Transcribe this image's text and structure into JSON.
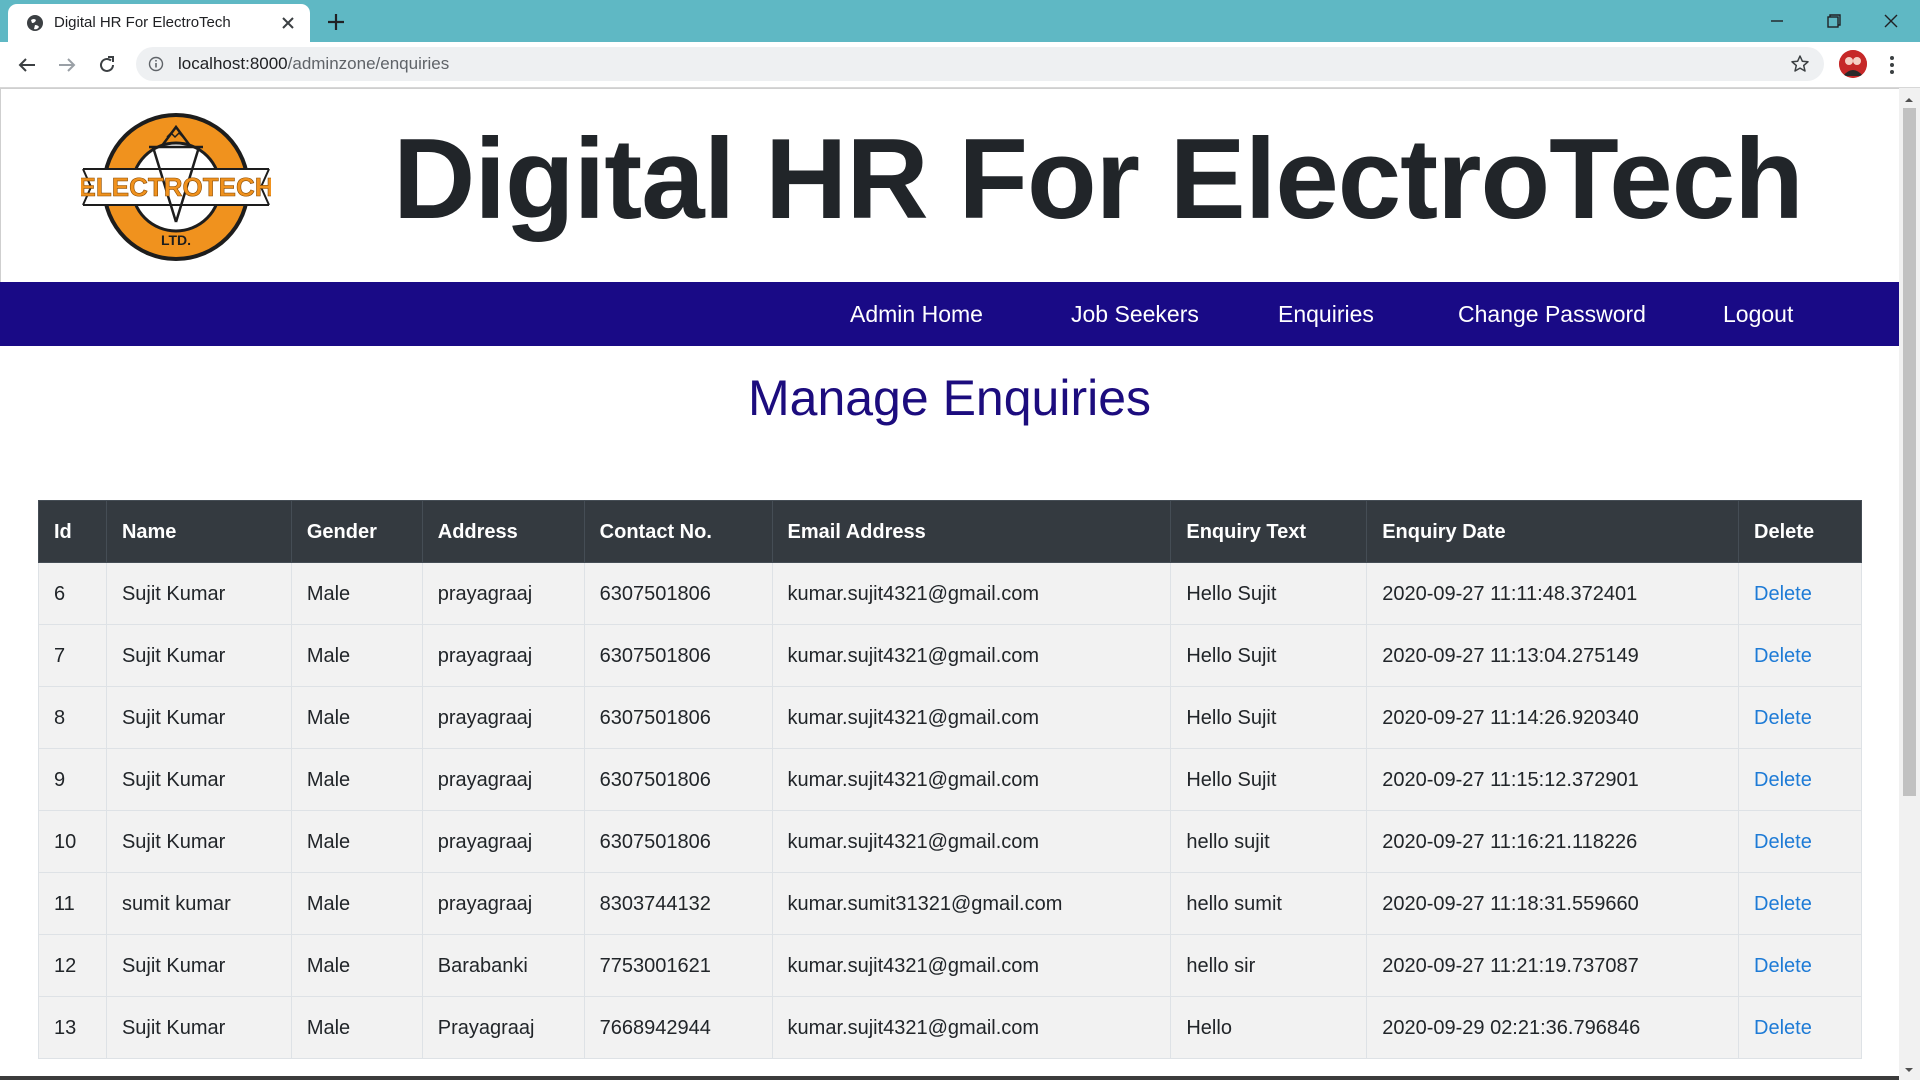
{
  "browser": {
    "tab_title": "Digital HR For ElectroTech",
    "url_host": "localhost:8000",
    "url_path": "/adminzone/enquiries"
  },
  "header": {
    "logo_text": "ELECTROTECH",
    "logo_subtext": "LTD.",
    "site_title": "Digital HR For ElectroTech"
  },
  "nav": {
    "items": [
      {
        "label": "Admin Home"
      },
      {
        "label": "Job Seekers"
      },
      {
        "label": "Enquiries"
      },
      {
        "label": "Change Password"
      },
      {
        "label": "Logout"
      }
    ]
  },
  "page": {
    "heading": "Manage Enquiries"
  },
  "table": {
    "columns": [
      "Id",
      "Name",
      "Gender",
      "Address",
      "Contact No.",
      "Email Address",
      "Enquiry Text",
      "Enquiry Date",
      "Delete"
    ],
    "rows": [
      {
        "id": "6",
        "name": "Sujit Kumar",
        "gender": "Male",
        "address": "prayagraaj",
        "contact": "6307501806",
        "email": "kumar.sujit4321@gmail.com",
        "text": "Hello Sujit",
        "date": "2020-09-27 11:11:48.372401",
        "delete": "Delete"
      },
      {
        "id": "7",
        "name": "Sujit Kumar",
        "gender": "Male",
        "address": "prayagraaj",
        "contact": "6307501806",
        "email": "kumar.sujit4321@gmail.com",
        "text": "Hello Sujit",
        "date": "2020-09-27 11:13:04.275149",
        "delete": "Delete"
      },
      {
        "id": "8",
        "name": "Sujit Kumar",
        "gender": "Male",
        "address": "prayagraaj",
        "contact": "6307501806",
        "email": "kumar.sujit4321@gmail.com",
        "text": "Hello Sujit",
        "date": "2020-09-27 11:14:26.920340",
        "delete": "Delete"
      },
      {
        "id": "9",
        "name": "Sujit Kumar",
        "gender": "Male",
        "address": "prayagraaj",
        "contact": "6307501806",
        "email": "kumar.sujit4321@gmail.com",
        "text": "Hello Sujit",
        "date": "2020-09-27 11:15:12.372901",
        "delete": "Delete"
      },
      {
        "id": "10",
        "name": "Sujit Kumar",
        "gender": "Male",
        "address": "prayagraaj",
        "contact": "6307501806",
        "email": "kumar.sujit4321@gmail.com",
        "text": "hello sujit",
        "date": "2020-09-27 11:16:21.118226",
        "delete": "Delete"
      },
      {
        "id": "11",
        "name": "sumit kumar",
        "gender": "Male",
        "address": "prayagraaj",
        "contact": "8303744132",
        "email": "kumar.sumit31321@gmail.com",
        "text": "hello sumit",
        "date": "2020-09-27 11:18:31.559660",
        "delete": "Delete"
      },
      {
        "id": "12",
        "name": "Sujit Kumar",
        "gender": "Male",
        "address": "Barabanki",
        "contact": "7753001621",
        "email": "kumar.sujit4321@gmail.com",
        "text": "hello sir",
        "date": "2020-09-27 11:21:19.737087",
        "delete": "Delete"
      },
      {
        "id": "13",
        "name": "Sujit Kumar",
        "gender": "Male",
        "address": "Prayagraaj",
        "contact": "7668942944",
        "email": "kumar.sujit4321@gmail.com",
        "text": "Hello",
        "date": "2020-09-29 02:21:36.796846",
        "delete": "Delete"
      }
    ]
  },
  "colors": {
    "tabbar": "#5fb8c4",
    "navbar": "#190a86",
    "heading": "#1c0c7e",
    "table_header": "#343a40",
    "link": "#1e7bd6",
    "logo_orange": "#f0921e"
  }
}
